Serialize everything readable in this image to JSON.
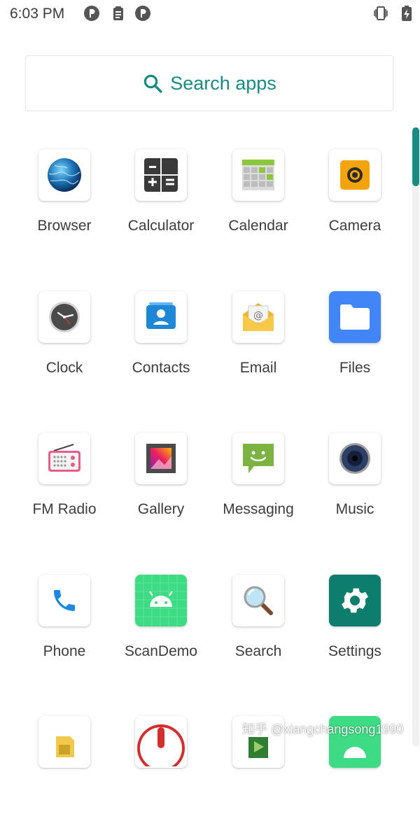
{
  "status_bar": {
    "time": "6:03 PM",
    "icons": [
      "pinned-app-icon",
      "clipboard-icon",
      "pinned-app-icon",
      "vibrate-icon",
      "battery-charging-icon"
    ]
  },
  "search": {
    "label": "Search apps",
    "icon": "search-icon",
    "accent": "#188c80"
  },
  "apps": [
    {
      "label": "Browser",
      "icon": "browser-icon"
    },
    {
      "label": "Calculator",
      "icon": "calculator-icon"
    },
    {
      "label": "Calendar",
      "icon": "calendar-icon"
    },
    {
      "label": "Camera",
      "icon": "camera-icon"
    },
    {
      "label": "Clock",
      "icon": "clock-icon"
    },
    {
      "label": "Contacts",
      "icon": "contacts-icon"
    },
    {
      "label": "Email",
      "icon": "email-icon"
    },
    {
      "label": "Files",
      "icon": "files-icon"
    },
    {
      "label": "FM Radio",
      "icon": "fm-radio-icon"
    },
    {
      "label": "Gallery",
      "icon": "gallery-icon"
    },
    {
      "label": "Messaging",
      "icon": "messaging-icon"
    },
    {
      "label": "Music",
      "icon": "music-icon"
    },
    {
      "label": "Phone",
      "icon": "phone-icon"
    },
    {
      "label": "ScanDemo",
      "icon": "android-icon"
    },
    {
      "label": "Search",
      "icon": "magnifier-icon"
    },
    {
      "label": "Settings",
      "icon": "settings-gear-icon"
    }
  ],
  "partial_row_icons": [
    "sim-toolkit-icon",
    "sound-recorder-icon",
    "video-player-icon",
    "android-icon"
  ],
  "watermark": "知乎 @xiangchangsong1990"
}
